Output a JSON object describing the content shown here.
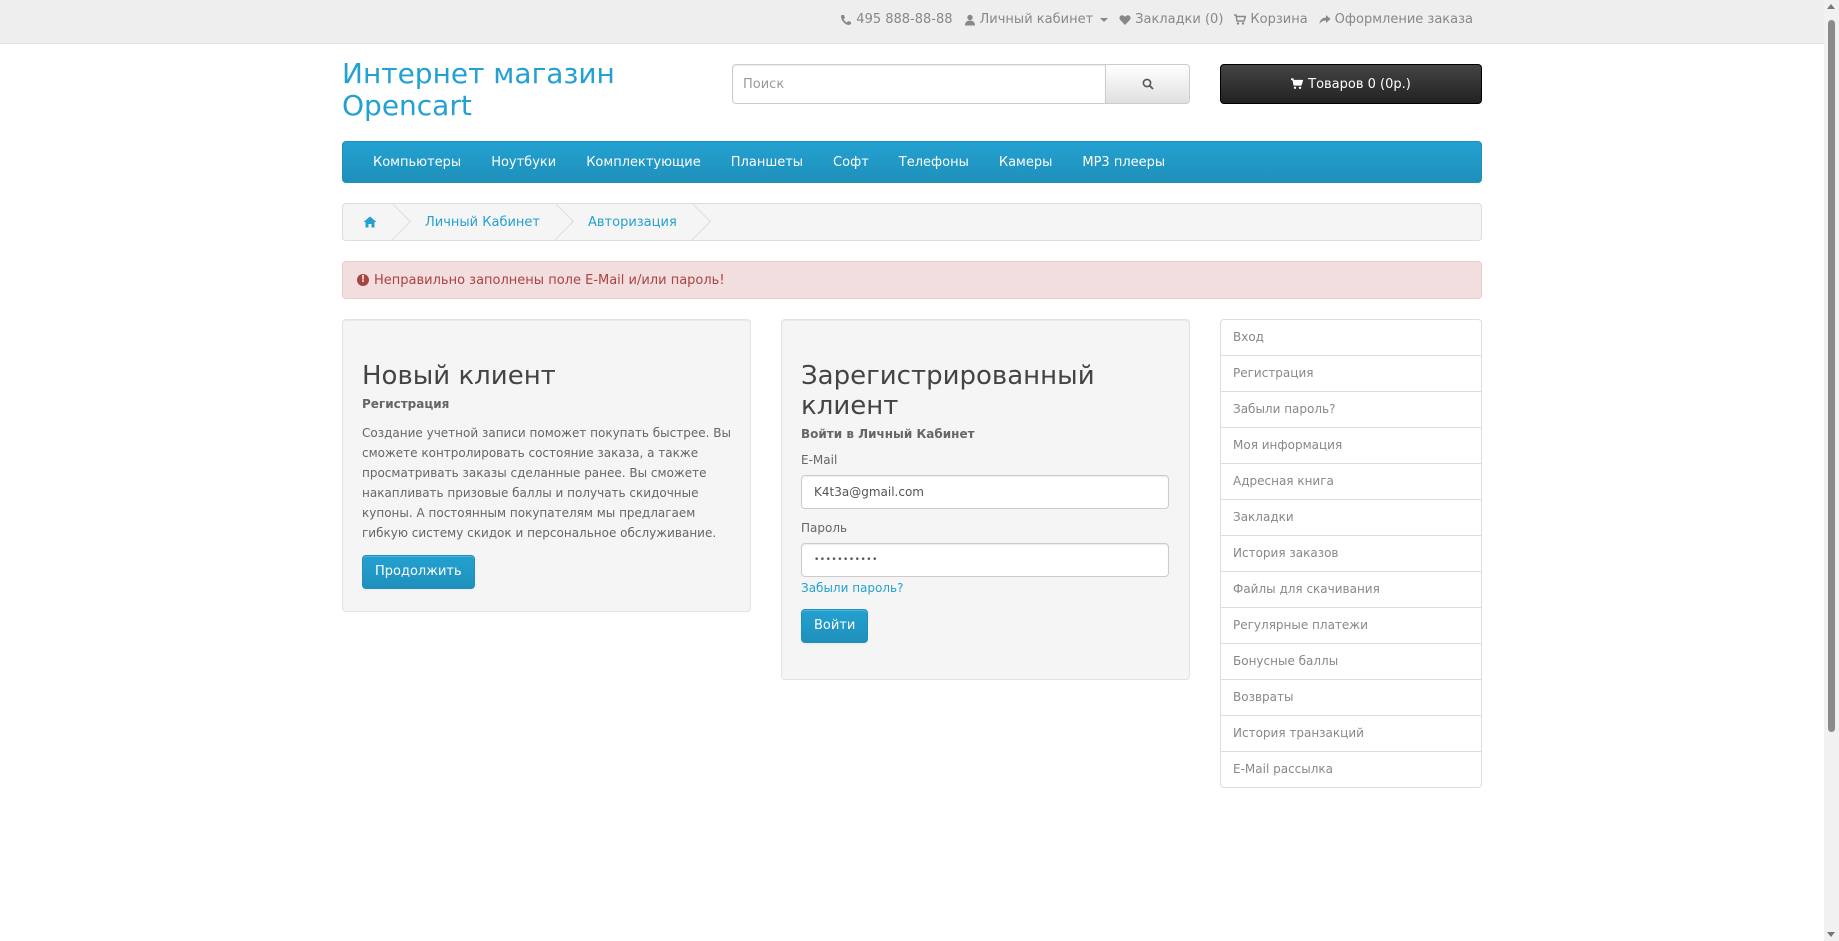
{
  "topbar": {
    "phone": "495 888-88-88",
    "account": "Личный кабинет",
    "wishlist": "Закладки (0)",
    "cart": "Корзина",
    "checkout": "Оформление заказа"
  },
  "header": {
    "logo": "Интернет магазин Opencart",
    "search_placeholder": "Поиск",
    "cart_button": "Товаров 0 (0р.)"
  },
  "menu": [
    "Компьютеры",
    "Ноутбуки",
    "Комплектующие",
    "Планшеты",
    "Софт",
    "Телефоны",
    "Камеры",
    "MP3 плееры"
  ],
  "breadcrumb": [
    "Личный Кабинет",
    "Авторизация"
  ],
  "alert": "Неправильно заполнены поле E-Mail и/или пароль!",
  "new_client": {
    "title": "Новый клиент",
    "subtitle": "Регистрация",
    "text": "Создание учетной записи поможет покупать быстрее. Вы сможете контролировать состояние заказа, а также просматривать заказы сделанные ранее. Вы сможете накапливать призовые баллы и получать скидочные купоны. А постоянным покупателям мы предлагаем гибкую систему скидок и персональное обслуживание.",
    "button": "Продолжить"
  },
  "returning": {
    "title": "Зарегистрированный клиент",
    "subtitle": "Войти в Личный Кабинет",
    "email_label": "E-Mail",
    "email_value": "K4t3a@gmail.com",
    "password_label": "Пароль",
    "password_value": "•••••••••••",
    "forgot": "Забыли пароль?",
    "button": "Войти"
  },
  "sidebar": [
    "Вход",
    "Регистрация",
    "Забыли пароль?",
    "Моя информация",
    "Адресная книга",
    "Закладки",
    "История заказов",
    "Файлы для скачивания",
    "Регулярные платежи",
    "Бонусные баллы",
    "Возвраты",
    "История транзакций",
    "E-Mail рассылка"
  ],
  "colors": {
    "accent": "#23a1d1",
    "alert_bg": "#f2dede",
    "alert_text": "#a94442",
    "cart_bg": "#222222"
  }
}
